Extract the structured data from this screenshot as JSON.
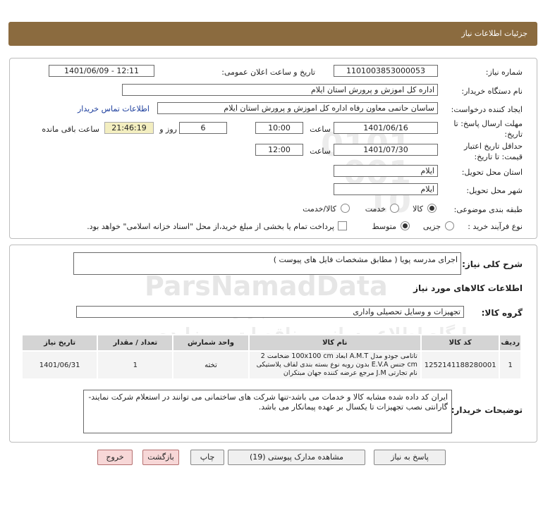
{
  "header": {
    "title": "جزئیات اطلاعات نیاز"
  },
  "form": {
    "need_number_label": "شماره نیاز:",
    "need_number": "1101003853000053",
    "announce_label": "تاریخ و ساعت اعلان عمومی:",
    "announce_value": "1401/06/09 - 12:11",
    "buyer_org_label": "نام دستگاه خریدار:",
    "buyer_org": "اداره کل اموزش و پرورش استان ایلام",
    "creator_label": "ایجاد کننده درخواست:",
    "creator": "ساسان حاتمی معاون رفاه  اداره کل اموزش و پرورش استان ایلام",
    "contact_link": "اطلاعات تماس خریدار",
    "deadline_label_1": "مهلت ارسال پاسخ: تا",
    "deadline_label_2": "تاریخ:",
    "deadline_date": "1401/06/16",
    "time_label": "ساعت",
    "deadline_time": "10:00",
    "days_value": "6",
    "days_label": "روز و",
    "remaining_time": "21:46:19",
    "remaining_label": "ساعت باقی مانده",
    "validity_label_1": "حداقل تاریخ اعتبار",
    "validity_label_2": "قیمت: تا تاریخ:",
    "validity_date": "1401/07/30",
    "validity_time_label": "ساعت",
    "validity_time": "12:00",
    "province_label": "استان محل تحویل:",
    "province": "ایلام",
    "city_label": "شهر محل تحویل:",
    "city": "ایلام",
    "category_label": "طبقه بندی موضوعی:",
    "category_options": [
      "کالا",
      "خدمت",
      "کالا/خدمت"
    ],
    "category_selected": "کالا",
    "process_label": "نوع فرآیند خرید :",
    "process_options": [
      "جزیی",
      "متوسط"
    ],
    "process_selected": "متوسط",
    "payment_note": "پرداخت تمام یا بخشی از مبلغ خرید،از محل \"اسناد خزانه اسلامی\" خواهد بود."
  },
  "summary": {
    "label": "شرح کلی نیاز:",
    "value": "اجرای مدرسه پویا ( مطابق مشخصات فایل های پیوست )"
  },
  "goods": {
    "section_title": "اطلاعات کالاهای مورد نیاز",
    "group_label": "گروه کالا:",
    "group_value": "تجهیزات و وسایل تحصیلی واداری",
    "columns": [
      "ردیف",
      "کد کالا",
      "نام کالا",
      "واحد شمارش",
      "تعداد / مقدار",
      "تاریخ نیاز"
    ],
    "rows": [
      {
        "row": "1",
        "code": "1252141188280001",
        "name": "تاتامی جودو مدل A.M.T ابعاد 100x100 cm ضخامت 2 cm جنس E.V.A بدون رویه نوع بسته بندی لفاف پلاستیکی نام تجارتی J.M مرجع عرضه کننده جهان مبتکران",
        "unit": "تخته",
        "qty": "1",
        "date": "1401/06/31"
      }
    ]
  },
  "buyer_notes": {
    "label": "توضیحات خریدار:",
    "text": "ایران کد داده شده مشابه کالا و خدمات می باشد-تنها شرکت های ساختمانی می توانند در استعلام شرکت نمایند- گارانتی نصب تجهیزات تا یکسال بر عهده پیمانکار می باشد."
  },
  "buttons": {
    "reply": "پاسخ به نیاز",
    "attachments": "مشاهده مدارک پیوستی (19)",
    "print": "چاپ",
    "back": "بازگشت",
    "exit": "خروج"
  },
  "watermark": {
    "brand": "ParsNamadData",
    "tagline": "پایگاه اطلاع رسانی مناقصات و مزایده",
    "sub": "پارس نماد داده"
  },
  "colors": {
    "title_bar": "#8b6b3f",
    "timer_bg": "#f3eec0",
    "link": "#1a3c9c"
  }
}
